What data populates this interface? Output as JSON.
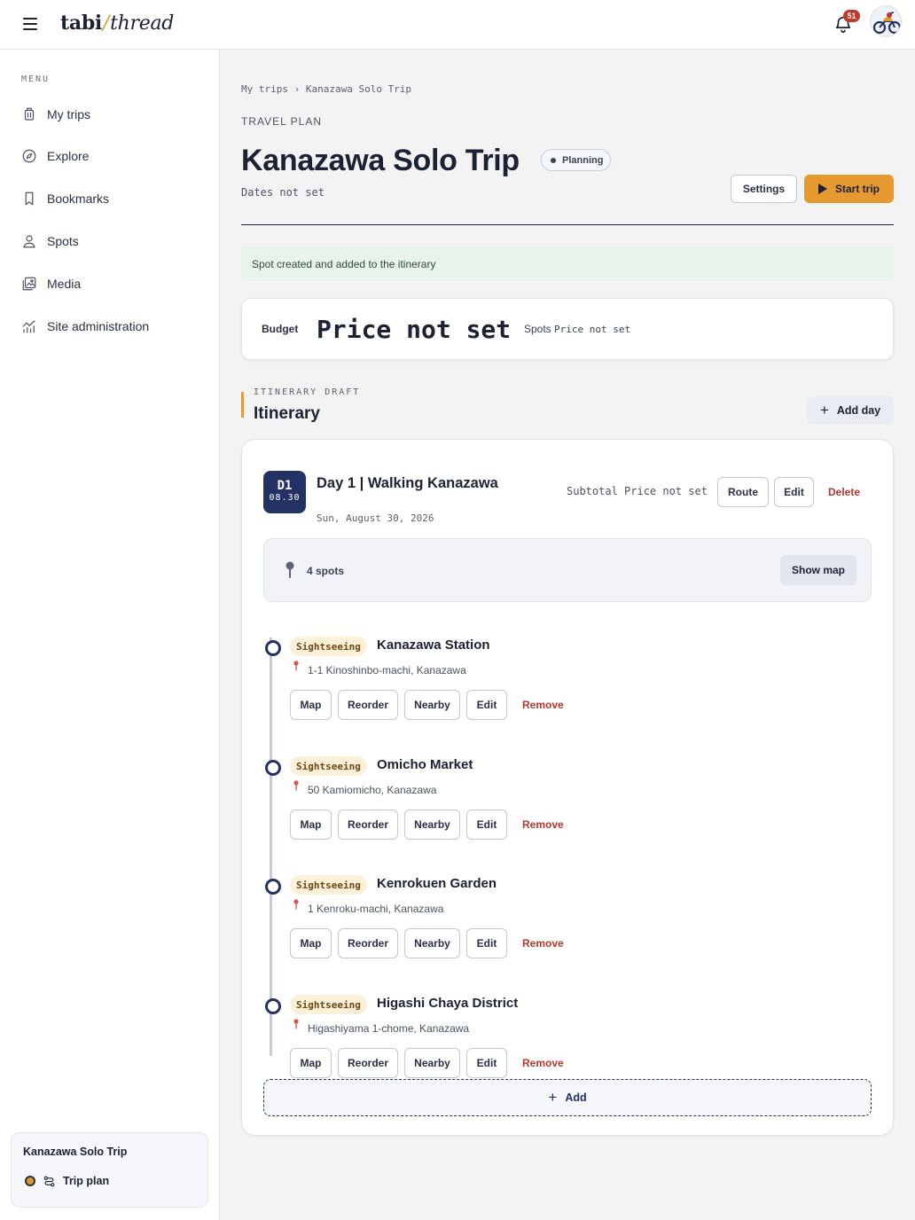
{
  "app": {
    "logo_main": "tabi",
    "logo_slash": "/",
    "logo_sub": "thread",
    "notification_count": "51"
  },
  "sidebar": {
    "menu_label": "MENU",
    "items": [
      {
        "label": "My trips",
        "icon": "luggage-icon"
      },
      {
        "label": "Explore",
        "icon": "compass-icon"
      },
      {
        "label": "Bookmarks",
        "icon": "bookmark-icon"
      },
      {
        "label": "Spots",
        "icon": "person-pin-icon"
      },
      {
        "label": "Media",
        "icon": "image-icon"
      },
      {
        "label": "Site administration",
        "icon": "chart-icon"
      }
    ],
    "trip_card": {
      "title": "Kanazawa Solo Trip",
      "link": "Trip plan"
    }
  },
  "page": {
    "breadcrumb": "My trips › Kanazawa Solo Trip",
    "kicker": "TRAVEL PLAN",
    "title": "Kanazawa Solo Trip",
    "status": "Planning",
    "dates": "Dates not set",
    "settings_label": "Settings",
    "start_label": "Start trip",
    "alert": "Spot created and added to the itinerary"
  },
  "budget": {
    "label": "Budget",
    "value": "Price not set",
    "spots_label": "Spots",
    "spots_value": "Price not set"
  },
  "itinerary": {
    "kicker": "ITINERARY DRAFT",
    "title": "Itinerary",
    "add_day_label": "Add day",
    "day": {
      "badge_day": "D1",
      "badge_date": "08.30",
      "title": "Day 1 | Walking Kanazawa",
      "date": "Sun, August 30, 2026",
      "subtotal_label": "Subtotal",
      "subtotal_value": "Price not set",
      "route_label": "Route",
      "edit_label": "Edit",
      "delete_label": "Delete",
      "spots_count": "4 spots",
      "show_map_label": "Show map",
      "spot_buttons": {
        "map": "Map",
        "reorder": "Reorder",
        "nearby": "Nearby",
        "edit": "Edit",
        "remove": "Remove"
      },
      "spots": [
        {
          "category": "Sightseeing",
          "name": "Kanazawa Station",
          "address": "1-1 Kinoshinbo-machi, Kanazawa"
        },
        {
          "category": "Sightseeing",
          "name": "Omicho Market",
          "address": "50 Kamiomicho, Kanazawa"
        },
        {
          "category": "Sightseeing",
          "name": "Kenrokuen Garden",
          "address": "1 Kenroku-machi, Kanazawa"
        },
        {
          "category": "Sightseeing",
          "name": "Higashi Chaya District",
          "address": "Higashiyama 1-chome, Kanazawa"
        }
      ],
      "add_label": "Add"
    }
  },
  "colors": {
    "accent": "#e6992f",
    "navy": "#233164",
    "danger": "#b8372a",
    "success_bg": "#e8f3ec"
  }
}
